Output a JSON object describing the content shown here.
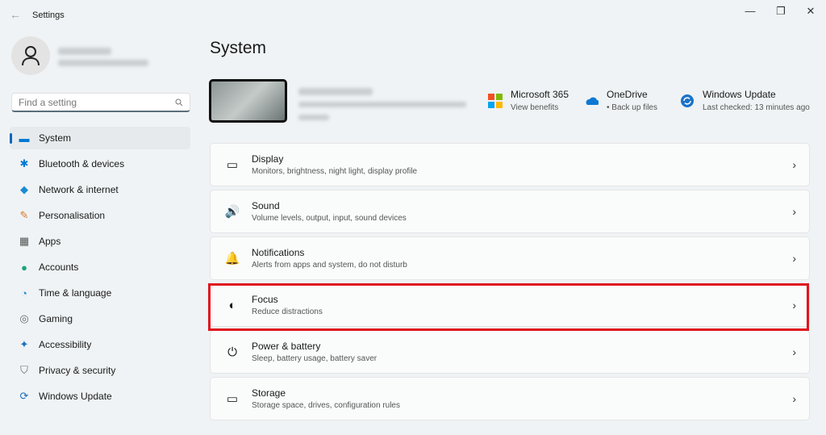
{
  "window": {
    "title": "Settings",
    "back": "←",
    "minimize": "—",
    "restore": "❐",
    "close": "✕"
  },
  "search": {
    "placeholder": "Find a setting",
    "icon": "search-icon"
  },
  "nav": [
    {
      "label": "System",
      "icon": "▬",
      "color": "#0078d4"
    },
    {
      "label": "Bluetooth & devices",
      "icon": "✱",
      "color": "#0078d4"
    },
    {
      "label": "Network & internet",
      "icon": "◆",
      "color": "#1a8ad4"
    },
    {
      "label": "Personalisation",
      "icon": "✎",
      "color": "#d87a2a"
    },
    {
      "label": "Apps",
      "icon": "▦",
      "color": "#555"
    },
    {
      "label": "Accounts",
      "icon": "●",
      "color": "#1ea27a"
    },
    {
      "label": "Time & language",
      "icon": "◔",
      "color": "#1a8ad4"
    },
    {
      "label": "Gaming",
      "icon": "◎",
      "color": "#666"
    },
    {
      "label": "Accessibility",
      "icon": "✦",
      "color": "#1a6fc0"
    },
    {
      "label": "Privacy & security",
      "icon": "⛉",
      "color": "#666"
    },
    {
      "label": "Windows Update",
      "icon": "⟳",
      "color": "#1a6fc0"
    }
  ],
  "page": {
    "title": "System"
  },
  "quick": [
    {
      "title": "Microsoft 365",
      "sub": "View benefits"
    },
    {
      "title": "OneDrive",
      "sub": "• Back up files"
    },
    {
      "title": "Windows Update",
      "sub": "Last checked: 13 minutes ago"
    }
  ],
  "cards": [
    {
      "title": "Display",
      "desc": "Monitors, brightness, night light, display profile",
      "icon": "▭"
    },
    {
      "title": "Sound",
      "desc": "Volume levels, output, input, sound devices",
      "icon": "🔊"
    },
    {
      "title": "Notifications",
      "desc": "Alerts from apps and system, do not disturb",
      "icon": "🔔"
    },
    {
      "title": "Focus",
      "desc": "Reduce distractions",
      "icon": "◐"
    },
    {
      "title": "Power & battery",
      "desc": "Sleep, battery usage, battery saver",
      "icon": "⏻"
    },
    {
      "title": "Storage",
      "desc": "Storage space, drives, configuration rules",
      "icon": "▭"
    }
  ],
  "chevron": "›"
}
